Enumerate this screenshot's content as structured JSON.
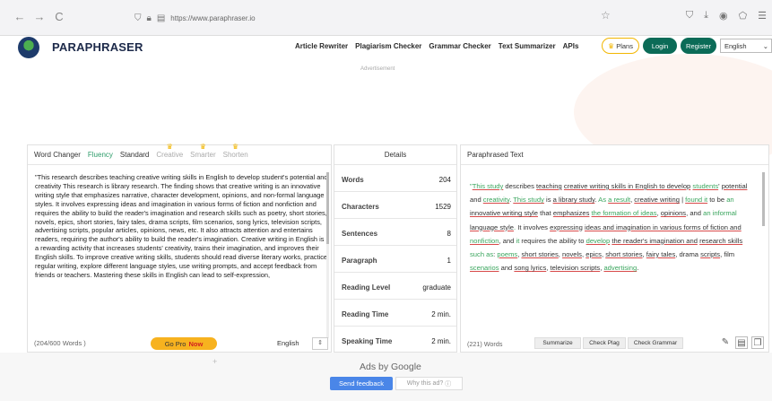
{
  "browser": {
    "back": "←",
    "forward": "→",
    "reload": "C",
    "url": "https://www.paraphraser.io"
  },
  "site": {
    "brand": "PARAPHRASER",
    "nav": [
      "Article Rewriter",
      "Plagiarism Checker",
      "Grammar Checker",
      "Text Summarizer",
      "APIs"
    ],
    "plans_label": "Plans",
    "login_label": "Login",
    "register_label": "Register",
    "language": "English",
    "ad_label": "Advertisement"
  },
  "modes": {
    "word_changer": "Word Changer",
    "fluency": "Fluency",
    "standard": "Standard",
    "creative": "Creative",
    "smarter": "Smarter",
    "shorten": "Shorten"
  },
  "input": {
    "text": "\"This research describes teaching creative writing skills in English to develop student's potential and creativity This research is library research. The finding shows that creative writing is an innovative writing style that emphasizes narrative, character development, opinions, and non-formal language styles. It involves expressing ideas and imagination in various forms of fiction and nonfiction and requires the ability to build the reader's imagination and research skills such as poetry, short stories, novels, epics, short stories, fairy tales, drama scripts, film scenarios, song lyrics, television scripts, advertising scripts, popular articles, opinions, news, etc. It also attracts attention and entertains readers, requiring the author's ability to build the reader's imagination. Creative writing in English is a rewarding activity that increases students' creativity, trains their imagination, and improves their English skills. To improve creative writing skills, students should read diverse literary works, practice regular writing, explore different language styles, use writing prompts, and accept feedback from friends or teachers. Mastering these skills in English can lead to self-expression,",
    "word_count": "(204/600 Words )",
    "go_pro": "Go Pro",
    "now": "Now",
    "language": "English"
  },
  "details": {
    "title": "Details",
    "rows": [
      {
        "label": "Words",
        "value": "204"
      },
      {
        "label": "Characters",
        "value": "1529"
      },
      {
        "label": "Sentences",
        "value": "8"
      },
      {
        "label": "Paragraph",
        "value": "1"
      },
      {
        "label": "Reading Level",
        "value": "graduate"
      },
      {
        "label": "Reading Time",
        "value": "2 min."
      },
      {
        "label": "Speaking Time",
        "value": "2 min."
      }
    ]
  },
  "output": {
    "title": "Paraphrased Text",
    "segments": [
      {
        "t": "\"",
        "c": "q"
      },
      {
        "t": "This study",
        "c": "gu"
      },
      {
        "t": " describes ",
        "c": ""
      },
      {
        "t": "teaching",
        "c": "u"
      },
      {
        "t": " ",
        "c": ""
      },
      {
        "t": "creative writing skills in English to develop",
        "c": "u"
      },
      {
        "t": " ",
        "c": ""
      },
      {
        "t": "students",
        "c": "gu"
      },
      {
        "t": "' ",
        "c": ""
      },
      {
        "t": "potential",
        "c": "u"
      },
      {
        "t": " and ",
        "c": ""
      },
      {
        "t": "creativity",
        "c": "gu"
      },
      {
        "t": ".",
        "c": ""
      },
      {
        "t": " ",
        "c": ""
      },
      {
        "t": "This study",
        "c": "gu"
      },
      {
        "t": " is ",
        "c": ""
      },
      {
        "t": "a library study",
        "c": "u"
      },
      {
        "t": ".",
        "c": ""
      },
      {
        "t": " ",
        "c": ""
      },
      {
        "t": "As ",
        "c": "g"
      },
      {
        "t": "a result",
        "c": "gu"
      },
      {
        "t": ", ",
        "c": ""
      },
      {
        "t": "creative writing",
        "c": "u"
      },
      {
        "t": " | ",
        "c": ""
      },
      {
        "t": "found it",
        "c": "gu"
      },
      {
        "t": " to be ",
        "c": ""
      },
      {
        "t": "an",
        "c": "g"
      },
      {
        "t": " ",
        "c": ""
      },
      {
        "t": "innovative writing style",
        "c": "u"
      },
      {
        "t": " that ",
        "c": ""
      },
      {
        "t": "emphasizes",
        "c": "u"
      },
      {
        "t": " ",
        "c": ""
      },
      {
        "t": "the formation of ideas",
        "c": "gu"
      },
      {
        "t": ", ",
        "c": ""
      },
      {
        "t": "opinions",
        "c": "u"
      },
      {
        "t": ", and ",
        "c": ""
      },
      {
        "t": "an informal",
        "c": "g"
      },
      {
        "t": " ",
        "c": ""
      },
      {
        "t": "language style",
        "c": "u"
      },
      {
        "t": ". ",
        "c": "g"
      },
      {
        "t": "It involves ",
        "c": ""
      },
      {
        "t": "expressing",
        "c": "u"
      },
      {
        "t": " ",
        "c": ""
      },
      {
        "t": "ideas and imagination in various forms of fiction and",
        "c": "u"
      },
      {
        "t": " ",
        "c": ""
      },
      {
        "t": "nonfiction",
        "c": "gu"
      },
      {
        "t": ", and ",
        "c": ""
      },
      {
        "t": "it",
        "c": "g"
      },
      {
        "t": " requires the ability to ",
        "c": ""
      },
      {
        "t": "develop",
        "c": "gu"
      },
      {
        "t": " ",
        "c": ""
      },
      {
        "t": "the reader's imagination and",
        "c": "u"
      },
      {
        "t": " ",
        "c": ""
      },
      {
        "t": "research skills",
        "c": "u"
      },
      {
        "t": " ",
        "c": ""
      },
      {
        "t": "such as",
        "c": "g"
      },
      {
        "t": ": ",
        "c": ""
      },
      {
        "t": "poems",
        "c": "gu"
      },
      {
        "t": ", ",
        "c": ""
      },
      {
        "t": "short stories",
        "c": "u"
      },
      {
        "t": ", ",
        "c": ""
      },
      {
        "t": "novels",
        "c": "u"
      },
      {
        "t": ", ",
        "c": ""
      },
      {
        "t": "epics",
        "c": "u"
      },
      {
        "t": ", ",
        "c": ""
      },
      {
        "t": "short stories",
        "c": "u"
      },
      {
        "t": ", ",
        "c": ""
      },
      {
        "t": "fairy tales",
        "c": "u"
      },
      {
        "t": ", drama ",
        "c": ""
      },
      {
        "t": "scripts",
        "c": "u"
      },
      {
        "t": ", film ",
        "c": ""
      },
      {
        "t": "scenarios",
        "c": "gu"
      },
      {
        "t": " and ",
        "c": ""
      },
      {
        "t": "song lyrics",
        "c": "u"
      },
      {
        "t": ", ",
        "c": ""
      },
      {
        "t": "television scripts",
        "c": "u"
      },
      {
        "t": ", ",
        "c": ""
      },
      {
        "t": "advertising",
        "c": "gu"
      },
      {
        "t": ".",
        "c": ""
      }
    ],
    "word_count": "(221) Words",
    "summarize": "Summarize",
    "check_plag": "Check Plag",
    "check_grammar": "Check Grammar"
  },
  "ads": {
    "ads_by": "Ads by Google",
    "send_feedback": "Send feedback",
    "why_ad": "Why this ad?"
  }
}
